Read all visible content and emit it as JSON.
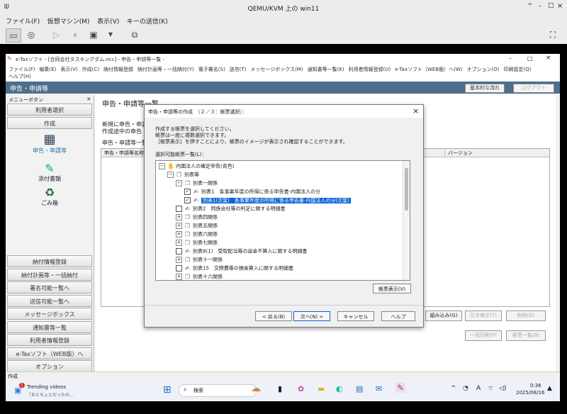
{
  "host": {
    "title": "QEMU/KVM 上の win11",
    "menu": [
      "ファイル(F)",
      "仮想マシン(M)",
      "表示(V)",
      "キーの送信(K)"
    ],
    "controls": [
      "^",
      "–",
      "□",
      "×"
    ]
  },
  "app": {
    "title": "e-Taxソフト - [合同会社タスキングダム.ncc] - 申告・申請等一覧 -",
    "menu_row1": [
      "ファイル(F)",
      "編集(E)",
      "表示(V)",
      "作成(C)",
      "納付情報登録",
      "納付計画等・一括納付(Y)",
      "電子署名(S)",
      "送信(T)",
      "メッセージボックス(M)",
      "通知書等一覧(K)",
      "利用者情報登録(U)",
      "e-Taxソフト（WEB版）へ(W)",
      "オプション(O)",
      "印刷設定(Q)"
    ],
    "menu_row2": [
      "ヘルプ(H)"
    ],
    "banner": "申告・申請等",
    "btn_basic_flow": "基本的な流れ",
    "btn_logout": "ログアウト",
    "window_controls": [
      "–",
      "□",
      "×"
    ]
  },
  "sidebar": {
    "menu_label": "メニューボタン",
    "close": "×",
    "top_buttons": [
      "利用者選択",
      "作成"
    ],
    "icon_items": [
      "申告・申請等",
      "添付書類",
      "ごみ箱"
    ],
    "bottom_buttons": [
      "納付情報登録",
      "納付計画等・一括納付",
      "署名可能一覧へ",
      "送信可能一覧へ",
      "メッセージボックス",
      "通知書等一覧",
      "利用者情報登録",
      "e-Taxソフト（WEB版）へ",
      "オプション"
    ]
  },
  "main": {
    "title": "申告・申請等一覧",
    "desc1": "新規に申告・申請等",
    "desc2": "作成途中の申告・",
    "list_label": "申告・申請等一覧",
    "col1": "申告・申請等名称",
    "col_version": "バージョン",
    "btn_load": "組み込み(G)",
    "btn_takeover": "引き継ぎ(T)",
    "btn_delete": "削除(D)",
    "btn_bulk_print": "一括印刷(P)",
    "btn_bulk_export": "帳票一覧(B)"
  },
  "dialog": {
    "title": "申告・申請等の作成　（２／３：帳票選択）：",
    "close": "×",
    "instr1": "作成する帳票を選択してください。",
    "instr2": "帳票は一度に複数選択できます。",
    "instr3": "［帳票表示］を押すことにより、帳票のイメージが表示され確認することができます。",
    "list_label": "選択可能帳票一覧(L)：",
    "tree": [
      {
        "label": "内国法人の確定申告(青色)",
        "level": 0,
        "kind": "root"
      },
      {
        "label": "別表等",
        "level": 1,
        "kind": "folder"
      },
      {
        "label": "別表一関係",
        "level": 2,
        "kind": "folder"
      },
      {
        "label": "別表1　各事業年度の所得に係る申告書-内国法人の分",
        "level": 3,
        "kind": "doc",
        "checked": true
      },
      {
        "label": "別表1(次葉)　各事業年度の所得に係る申告書-内国法人の分(次葉)",
        "level": 3,
        "kind": "doc",
        "checked": true,
        "selected": true
      },
      {
        "label": "別表2　同族会社等の判定に関する明細書",
        "level": 2,
        "kind": "doc",
        "checked": false
      },
      {
        "label": "別表四関係",
        "level": 2,
        "kind": "folder"
      },
      {
        "label": "別表五関係",
        "level": 2,
        "kind": "folder"
      },
      {
        "label": "別表六関係",
        "level": 2,
        "kind": "folder"
      },
      {
        "label": "別表七関係",
        "level": 2,
        "kind": "folder"
      },
      {
        "label": "別表8(1)　受取配当等の益金不算入に関する明細書",
        "level": 2,
        "kind": "doc",
        "checked": false
      },
      {
        "label": "別表十一関係",
        "level": 2,
        "kind": "folder"
      },
      {
        "label": "別表15　交際費等の損金算入に関する明細書",
        "level": 2,
        "kind": "doc",
        "checked": false
      },
      {
        "label": "別表十六関係",
        "level": 2,
        "kind": "folder"
      }
    ],
    "btn_preview": "帳票表示(V)",
    "btn_back": "< 戻る(B)",
    "btn_next": "次へ(N) >",
    "btn_cancel": "キャンセル",
    "btn_help": "ヘルプ"
  },
  "status": {
    "text": "作成"
  },
  "taskbar": {
    "notif_count": "1",
    "news_title": "Trending videos",
    "news_sub": "「おとちょとだったの...",
    "search": "検索",
    "time": "0:36",
    "date": "2025/08/16",
    "tray_ime": "A"
  }
}
